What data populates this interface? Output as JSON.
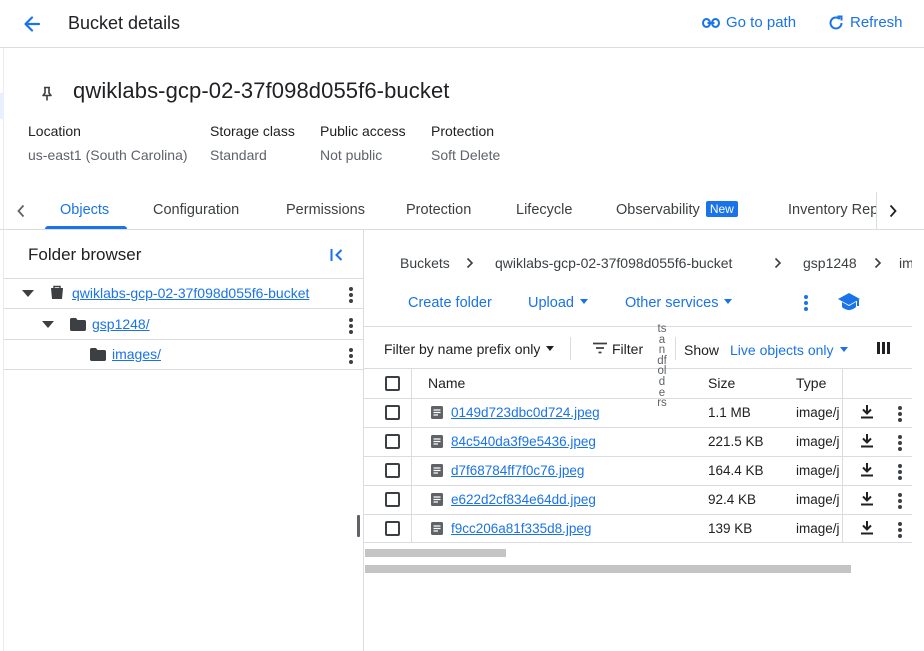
{
  "header": {
    "title": "Bucket details",
    "go_to_path": "Go to path",
    "refresh": "Refresh"
  },
  "bucket": {
    "name": "qwiklabs-gcp-02-37f098d055f6-bucket",
    "meta": [
      {
        "label": "Location",
        "value": "us-east1 (South Carolina)"
      },
      {
        "label": "Storage class",
        "value": "Standard"
      },
      {
        "label": "Public access",
        "value": "Not public"
      },
      {
        "label": "Protection",
        "value": "Soft Delete"
      }
    ]
  },
  "tabs": [
    {
      "label": "Objects",
      "active": true
    },
    {
      "label": "Configuration"
    },
    {
      "label": "Permissions"
    },
    {
      "label": "Protection"
    },
    {
      "label": "Lifecycle"
    },
    {
      "label": "Observability",
      "badge": "New"
    },
    {
      "label": "Inventory Rep"
    }
  ],
  "folder_browser": {
    "title": "Folder browser",
    "tree": [
      {
        "label": "qwiklabs-gcp-02-37f098d055f6-bucket",
        "type": "bucket"
      },
      {
        "label": "gsp1248/",
        "type": "folder"
      },
      {
        "label": "images/",
        "type": "folder"
      }
    ]
  },
  "breadcrumbs": [
    "Buckets",
    "qwiklabs-gcp-02-37f098d055f6-bucket",
    "gsp1248",
    "im"
  ],
  "actions": {
    "create_folder": "Create folder",
    "upload": "Upload",
    "other_services": "Other services"
  },
  "toolbar": {
    "filter_by": "Filter by name prefix only",
    "filter": "Filter",
    "show": "Show",
    "show_value": "Live objects only"
  },
  "vertical_text": "tsandfolders",
  "table": {
    "headers": {
      "name": "Name",
      "size": "Size",
      "type": "Type"
    },
    "rows": [
      {
        "name": "0149d723dbc0d724.jpeg",
        "size": "1.1 MB",
        "type": "image/j"
      },
      {
        "name": "84c540da3f9e5436.jpeg",
        "size": "221.5 KB",
        "type": "image/j"
      },
      {
        "name": "d7f68784ff7f0c76.jpeg",
        "size": "164.4 KB",
        "type": "image/j"
      },
      {
        "name": "e622d2cf834e64dd.jpeg",
        "size": "92.4 KB",
        "type": "image/j"
      },
      {
        "name": "f9cc206a81f335d8.jpeg",
        "size": "139 KB",
        "type": "image/j"
      }
    ]
  },
  "colors": {
    "accent": "#1a73e8",
    "text": "#202124",
    "muted": "#5f6368",
    "border": "#dadce0"
  }
}
